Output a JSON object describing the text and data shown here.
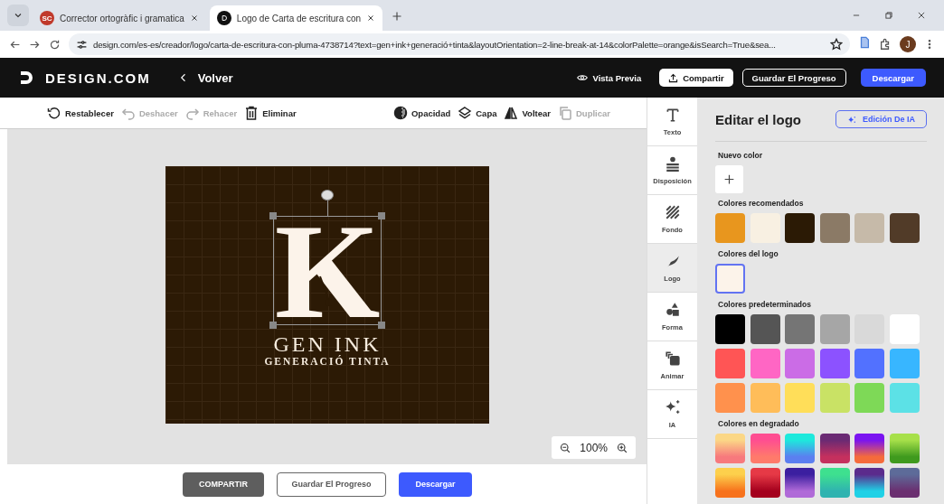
{
  "browser": {
    "tabs": [
      {
        "title": "Corrector ortogràfic i gramatica",
        "selected": false,
        "kind": "sc"
      },
      {
        "title": "Logo de Carta de escritura con",
        "selected": true,
        "kind": "d"
      }
    ],
    "favicon_text": "SC",
    "url": "design.com/es-es/creador/logo/carta-de-escritura-con-pluma-4738714?text=gen+ink+generació+tinta&layoutOrientation=2-line-break-at-14&colorPalette=orange&isSearch=True&sea...",
    "profile": "J"
  },
  "header": {
    "brand": "DESIGN.COM",
    "back": "Volver",
    "preview": "Vista Previa",
    "share": "Compartir",
    "save": "Guardar El Progreso",
    "download": "Descargar"
  },
  "toolbar": {
    "left": [
      {
        "label": "Restablecer",
        "kind": "reset",
        "disabled": false
      },
      {
        "label": "Deshacer",
        "kind": "undo",
        "disabled": true
      },
      {
        "label": "Rehacer",
        "kind": "redo",
        "disabled": true
      },
      {
        "label": "Eliminar",
        "kind": "delete",
        "disabled": false
      }
    ],
    "right": [
      {
        "label": "Opacidad",
        "kind": "opacity",
        "disabled": false
      },
      {
        "label": "Capa",
        "kind": "layer",
        "disabled": false
      },
      {
        "label": "Voltear",
        "kind": "flip",
        "disabled": false
      },
      {
        "label": "Duplicar",
        "kind": "duplicate",
        "disabled": true
      }
    ]
  },
  "canvas": {
    "monogram": "K",
    "name": "GEN INK",
    "tagline": "GENERACIÓ TINTA",
    "zoom": "100%"
  },
  "bottom": {
    "share": "COMPARTIR",
    "save": "Guardar El Progreso",
    "download": "Descargar"
  },
  "tools": [
    {
      "label": "Texto",
      "kind": "text",
      "selected": false
    },
    {
      "label": "Disposición",
      "kind": "layout",
      "selected": false
    },
    {
      "label": "Fondo",
      "kind": "background",
      "selected": false
    },
    {
      "label": "Logo",
      "kind": "logo",
      "selected": true
    },
    {
      "label": "Forma",
      "kind": "shape",
      "selected": false
    },
    {
      "label": "Animar",
      "kind": "animate",
      "selected": false
    },
    {
      "label": "IA",
      "kind": "ai",
      "selected": false
    }
  ],
  "panel": {
    "title": "Editar el logo",
    "ai_button": "Edición De IA",
    "new_color": "Nuevo color",
    "recommended": {
      "label": "Colores recomendados",
      "colors": [
        {
          "color": "#e8961e"
        },
        {
          "color": "#f8f0e2"
        },
        {
          "color": "#2b1a05"
        },
        {
          "color": "#8b7a66"
        },
        {
          "color": "#c6baa9"
        },
        {
          "color": "#513b28"
        }
      ]
    },
    "logo_colors": {
      "label": "Colores del logo",
      "colors": [
        {
          "color": "#fcf3ea",
          "selected": true
        }
      ]
    },
    "default": {
      "label": "Colores predeterminados",
      "colors": [
        {
          "color": "#000000"
        },
        {
          "color": "#555555"
        },
        {
          "color": "#757575"
        },
        {
          "color": "#a6a6a6"
        },
        {
          "color": "#d9d9d9"
        },
        {
          "color": "#ffffff"
        },
        {
          "color": "#ff5555"
        },
        {
          "color": "#ff66c4"
        },
        {
          "color": "#cb6ce6"
        },
        {
          "color": "#8c52ff"
        },
        {
          "color": "#5271ff"
        },
        {
          "color": "#38b6ff"
        },
        {
          "color": "#ff914d"
        },
        {
          "color": "#ffbd59"
        },
        {
          "color": "#ffde59"
        },
        {
          "color": "#c9e265"
        },
        {
          "color": "#7ed957"
        },
        {
          "color": "#5ce1e6"
        }
      ]
    },
    "gradients": {
      "label": "Colores en degradado",
      "items": [
        {
          "stops": [
            {
              "color": "#fbd786"
            },
            {
              "color": "#f7797d"
            }
          ]
        },
        {
          "stops": [
            {
              "color": "#ff4e91"
            },
            {
              "color": "#ff7a6b"
            }
          ]
        },
        {
          "stops": [
            {
              "color": "#1de9dc"
            },
            {
              "color": "#5b7ff0"
            }
          ]
        },
        {
          "stops": [
            {
              "color": "#6a2a73"
            },
            {
              "color": "#c5305e"
            }
          ]
        },
        {
          "stops": [
            {
              "color": "#7a14f0"
            },
            {
              "color": "#f56b3b"
            }
          ]
        },
        {
          "stops": [
            {
              "color": "#a7e04a"
            },
            {
              "color": "#3f9a1e"
            }
          ]
        },
        {
          "stops": [
            {
              "color": "#fdd04c"
            },
            {
              "color": "#f7721c"
            }
          ]
        },
        {
          "stops": [
            {
              "color": "#e63946"
            },
            {
              "color": "#a4001d"
            }
          ]
        },
        {
          "stops": [
            {
              "color": "#3b1fa0"
            },
            {
              "color": "#b06ad8"
            }
          ]
        },
        {
          "stops": [
            {
              "color": "#3ee08f"
            },
            {
              "color": "#2fb3b0"
            }
          ]
        },
        {
          "stops": [
            {
              "color": "#5b2b8c"
            },
            {
              "color": "#1fd1e6"
            }
          ]
        },
        {
          "stops": [
            {
              "color": "#5d6b99"
            },
            {
              "color": "#6b2f70"
            }
          ]
        }
      ]
    }
  }
}
